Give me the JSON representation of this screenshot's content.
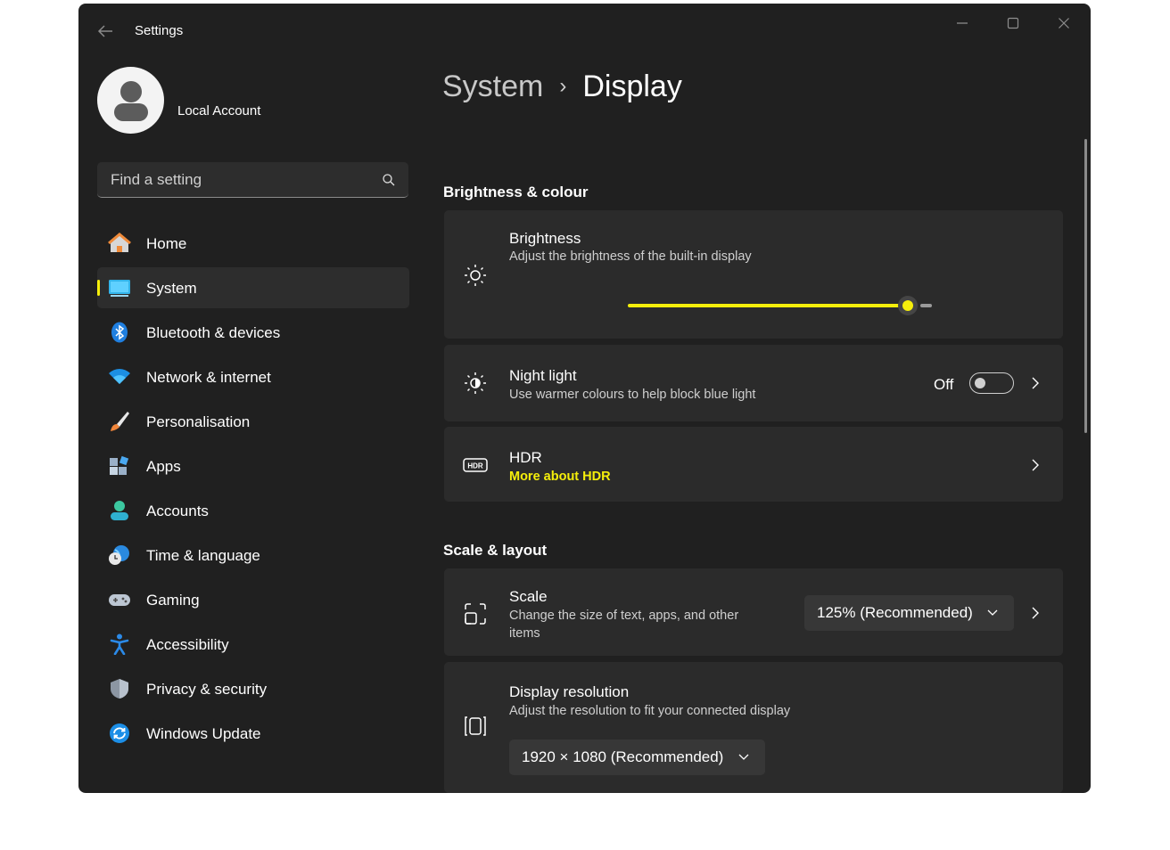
{
  "window": {
    "title": "Settings"
  },
  "account": {
    "name": "Local Account"
  },
  "search": {
    "placeholder": "Find a setting"
  },
  "nav": {
    "items": [
      {
        "label": "Home",
        "icon": "home-icon"
      },
      {
        "label": "System",
        "icon": "system-display-icon",
        "active": true
      },
      {
        "label": "Bluetooth & devices",
        "icon": "bluetooth-icon"
      },
      {
        "label": "Network & internet",
        "icon": "wifi-icon"
      },
      {
        "label": "Personalisation",
        "icon": "paintbrush-icon"
      },
      {
        "label": "Apps",
        "icon": "apps-icon"
      },
      {
        "label": "Accounts",
        "icon": "person-icon"
      },
      {
        "label": "Time & language",
        "icon": "globe-clock-icon"
      },
      {
        "label": "Gaming",
        "icon": "gamepad-icon"
      },
      {
        "label": "Accessibility",
        "icon": "accessibility-icon"
      },
      {
        "label": "Privacy & security",
        "icon": "shield-icon"
      },
      {
        "label": "Windows Update",
        "icon": "update-icon"
      }
    ]
  },
  "breadcrumb": {
    "parent": "System",
    "current": "Display"
  },
  "sections": {
    "brightness_colour": {
      "title": "Brightness & colour",
      "brightness": {
        "title": "Brightness",
        "subtitle": "Adjust the brightness of the built-in display",
        "value_fraction": 0.94
      },
      "night_light": {
        "title": "Night light",
        "subtitle": "Use warmer colours to help block blue light",
        "state": "Off"
      },
      "hdr": {
        "title": "HDR",
        "link": "More about HDR"
      }
    },
    "scale_layout": {
      "title": "Scale & layout",
      "scale": {
        "title": "Scale",
        "subtitle_line1": "Change the size of text, apps, and other",
        "subtitle_line2": "items",
        "value": "125% (Recommended)"
      },
      "resolution": {
        "title": "Display resolution",
        "subtitle": "Adjust the resolution to fit your connected display",
        "value": "1920 × 1080 (Recommended)"
      }
    }
  },
  "colors": {
    "accent": "#f5ee0b",
    "window_bg": "#202020",
    "card_bg": "#2b2b2b"
  }
}
